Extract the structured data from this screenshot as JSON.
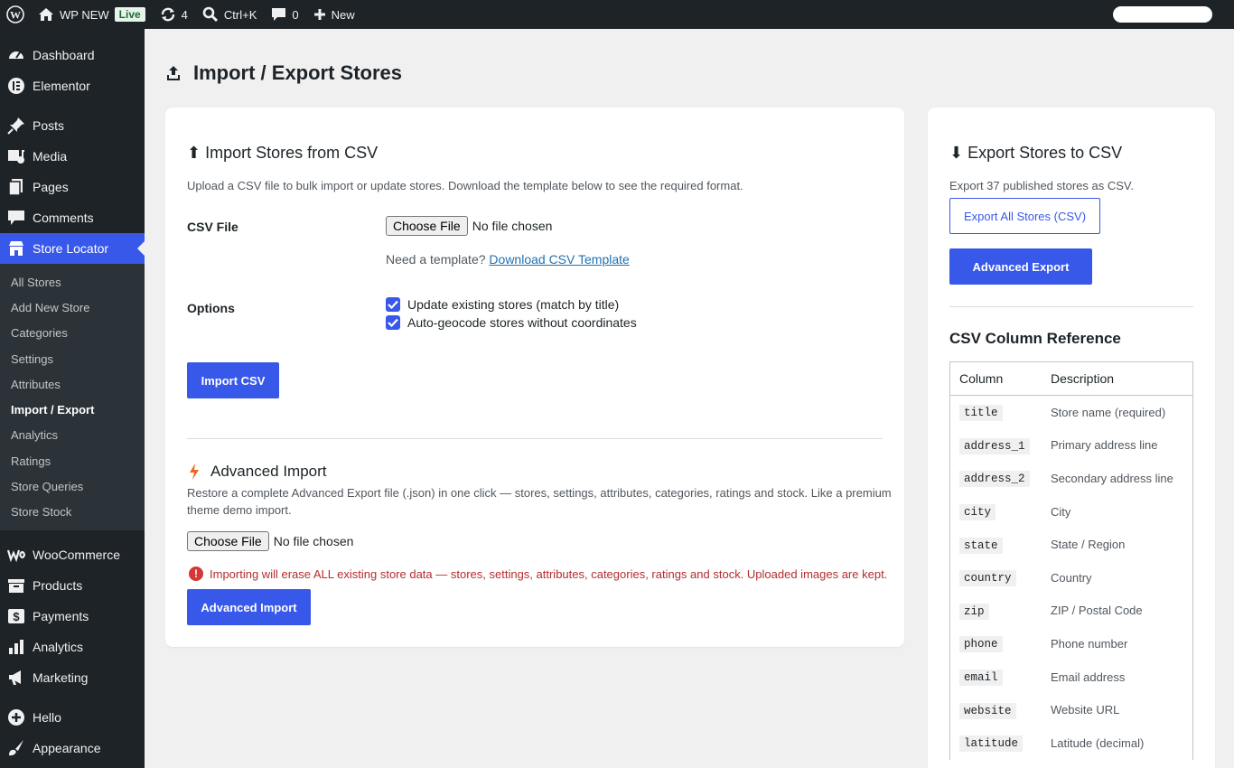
{
  "adminbar": {
    "site_name": "WP NEW",
    "live_badge": "Live",
    "updates_count": "4",
    "search_shortcut": "Ctrl+K",
    "comments_count": "0",
    "new_label": "New"
  },
  "sidebar": {
    "top_items": [
      {
        "label": "Dashboard",
        "icon": "dashboard-icon"
      },
      {
        "label": "Elementor",
        "icon": "elementor-icon"
      }
    ],
    "content_items": [
      {
        "label": "Posts",
        "icon": "pin-icon"
      },
      {
        "label": "Media",
        "icon": "media-icon"
      },
      {
        "label": "Pages",
        "icon": "pages-icon"
      },
      {
        "label": "Comments",
        "icon": "comment-icon"
      },
      {
        "label": "Store Locator",
        "icon": "store-locator-icon"
      }
    ],
    "submenu": [
      "All Stores",
      "Add New Store",
      "Categories",
      "Settings",
      "Attributes",
      "Import / Export",
      "Analytics",
      "Ratings",
      "Store Queries",
      "Store Stock"
    ],
    "commerce_items": [
      {
        "label": "WooCommerce",
        "icon": "woo-icon"
      },
      {
        "label": "Products",
        "icon": "products-icon"
      },
      {
        "label": "Payments",
        "icon": "payments-icon"
      },
      {
        "label": "Analytics",
        "icon": "analytics-icon"
      },
      {
        "label": "Marketing",
        "icon": "marketing-icon"
      }
    ],
    "bottom_items": [
      {
        "label": "Hello",
        "icon": "plus-circle-icon"
      },
      {
        "label": "Appearance",
        "icon": "brush-icon"
      }
    ]
  },
  "page": {
    "title": "Import / Export Stores"
  },
  "import": {
    "heading": "⬆ Import Stores from CSV",
    "description": "Upload a CSV file to bulk import or update stores. Download the template below to see the required format.",
    "csv_label": "CSV File",
    "choose_file": "Choose File",
    "no_file": "No file chosen",
    "template_prefix": "Need a template?",
    "template_link": "Download CSV Template",
    "options_label": "Options",
    "option_update": "Update existing stores (match by title)",
    "option_geocode": "Auto-geocode stores without coordinates",
    "import_button": "Import CSV"
  },
  "advanced_import": {
    "heading": "Advanced Import",
    "description": "Restore a complete Advanced Export file (.json) in one click — stores, settings, attributes, categories, ratings and stock. Like a premium theme demo import.",
    "choose_file": "Choose File",
    "no_file": "No file chosen",
    "warning": "Importing will erase ALL existing store data — stores, settings, attributes, categories, ratings and stock. Uploaded images are kept.",
    "button": "Advanced Import"
  },
  "export": {
    "heading": "⬇ Export Stores to CSV",
    "description": "Export 37 published stores as CSV.",
    "export_all_button": "Export All Stores (CSV)",
    "advanced_export_button": "Advanced Export"
  },
  "reference": {
    "heading": "CSV Column Reference",
    "col_header": "Column",
    "desc_header": "Description",
    "rows": [
      {
        "column": "title",
        "description": "Store name (required)"
      },
      {
        "column": "address_1",
        "description": "Primary address line"
      },
      {
        "column": "address_2",
        "description": "Secondary address line"
      },
      {
        "column": "city",
        "description": "City"
      },
      {
        "column": "state",
        "description": "State / Region"
      },
      {
        "column": "country",
        "description": "Country"
      },
      {
        "column": "zip",
        "description": "ZIP / Postal Code"
      },
      {
        "column": "phone",
        "description": "Phone number"
      },
      {
        "column": "email",
        "description": "Email address"
      },
      {
        "column": "website",
        "description": "Website URL"
      },
      {
        "column": "latitude",
        "description": "Latitude (decimal)"
      }
    ]
  },
  "colors": {
    "accent": "#3858e9",
    "adminbar_bg": "#1d2327",
    "warning": "#b32d2e"
  }
}
